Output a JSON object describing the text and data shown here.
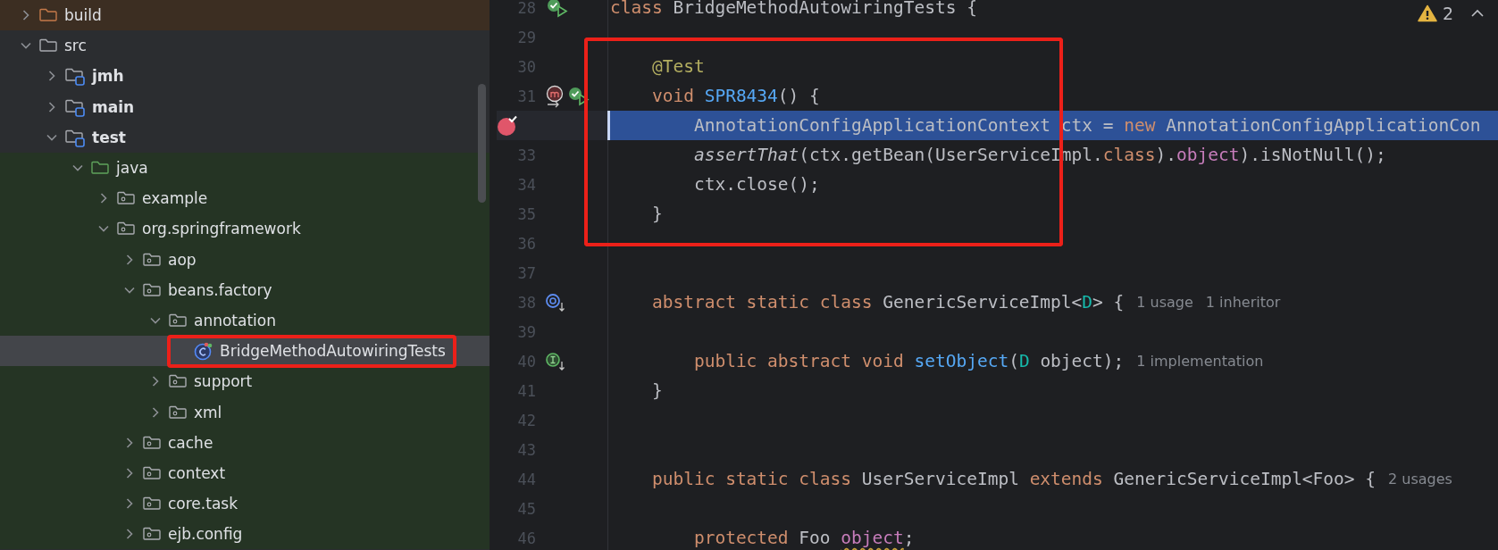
{
  "project_tree": {
    "items": [
      {
        "label": "build",
        "kind": "excluded",
        "test_sources": false,
        "expanded": false,
        "selected": false
      },
      {
        "label": "src",
        "kind": "folder",
        "test_sources": false,
        "expanded": true,
        "selected": false,
        "children": [
          {
            "label": "jmh",
            "kind": "module",
            "test_sources": false,
            "expanded": false,
            "selected": false
          },
          {
            "label": "main",
            "kind": "module",
            "test_sources": false,
            "expanded": false,
            "selected": false
          },
          {
            "label": "test",
            "kind": "module",
            "test_sources": false,
            "expanded": true,
            "selected": false,
            "children": [
              {
                "label": "java",
                "kind": "source-root",
                "test_sources": true,
                "expanded": true,
                "selected": false,
                "children": [
                  {
                    "label": "example",
                    "kind": "package",
                    "test_sources": true,
                    "expanded": false,
                    "selected": false
                  },
                  {
                    "label": "org.springframework",
                    "kind": "package",
                    "test_sources": true,
                    "expanded": true,
                    "selected": false,
                    "children": [
                      {
                        "label": "aop",
                        "kind": "package",
                        "test_sources": true,
                        "expanded": false,
                        "selected": false
                      },
                      {
                        "label": "beans.factory",
                        "kind": "package",
                        "test_sources": true,
                        "expanded": true,
                        "selected": false,
                        "children": [
                          {
                            "label": "annotation",
                            "kind": "package",
                            "test_sources": true,
                            "expanded": true,
                            "selected": false,
                            "children": [
                              {
                                "label": "BridgeMethodAutowiringTests",
                                "kind": "class",
                                "selected": true,
                                "framed": true
                              }
                            ]
                          },
                          {
                            "label": "support",
                            "kind": "package",
                            "test_sources": true,
                            "expanded": false,
                            "selected": false
                          },
                          {
                            "label": "xml",
                            "kind": "package",
                            "test_sources": true,
                            "expanded": false,
                            "selected": false
                          }
                        ]
                      },
                      {
                        "label": "cache",
                        "kind": "package",
                        "test_sources": true,
                        "expanded": false,
                        "selected": false
                      },
                      {
                        "label": "context",
                        "kind": "package",
                        "test_sources": true,
                        "expanded": false,
                        "selected": false
                      },
                      {
                        "label": "core.task",
                        "kind": "package",
                        "test_sources": true,
                        "expanded": false,
                        "selected": false
                      },
                      {
                        "label": "ejb.config",
                        "kind": "package",
                        "test_sources": true,
                        "expanded": false,
                        "selected": false
                      }
                    ]
                  }
                ]
              }
            ]
          }
        ]
      }
    ]
  },
  "editor": {
    "warning_count": "2",
    "lines": [
      {
        "number": "28",
        "gutter": [
          {
            "kind": "run"
          }
        ],
        "tokens": [
          {
            "text": "class",
            "kind": "keyword"
          },
          {
            "text": " BridgeMethodAutowiringTests {",
            "kind": "plain"
          }
        ]
      },
      {
        "number": "29"
      },
      {
        "number": "30",
        "framed": true,
        "tokens": [
          {
            "text": "    @Test",
            "kind": "annotation"
          }
        ]
      },
      {
        "number": "31",
        "framed": true,
        "gutter": [
          {
            "kind": "method"
          },
          {
            "kind": "run"
          }
        ],
        "tokens": [
          {
            "text": "    void",
            "kind": "keyword"
          },
          {
            "text": " SPR8434",
            "kind": "declaration"
          },
          {
            "text": "() {",
            "kind": "plain"
          }
        ]
      },
      {
        "framed": true,
        "current": true,
        "gutter": [
          {
            "kind": "breakpoint"
          }
        ],
        "tokens": [
          {
            "text": "        AnnotationConfigApplicationContext ctx = ",
            "kind": "plain"
          },
          {
            "text": "new",
            "kind": "keyword"
          },
          {
            "text": " AnnotationConfigApplicationCon",
            "kind": "plain"
          }
        ]
      },
      {
        "number": "33",
        "framed": true,
        "tokens": [
          {
            "text": "        assertThat",
            "kind": "static-call"
          },
          {
            "text": "(ctx.getBean(UserServiceImpl.",
            "kind": "plain"
          },
          {
            "text": "class",
            "kind": "keyword"
          },
          {
            "text": ").",
            "kind": "plain"
          },
          {
            "text": "object",
            "kind": "field"
          },
          {
            "text": ").isNotNull();",
            "kind": "plain"
          }
        ]
      },
      {
        "number": "34",
        "framed": true,
        "tokens": [
          {
            "text": "        ctx.close();",
            "kind": "plain"
          }
        ]
      },
      {
        "number": "35",
        "framed": true,
        "tokens": [
          {
            "text": "    }",
            "kind": "plain"
          }
        ]
      },
      {
        "number": "36"
      },
      {
        "number": "37"
      },
      {
        "number": "38",
        "gutter": [
          {
            "kind": "implemented"
          }
        ],
        "tokens": [
          {
            "text": "    abstract static class",
            "kind": "keyword"
          },
          {
            "text": " GenericServiceImpl<",
            "kind": "plain"
          },
          {
            "text": "D",
            "kind": "type-param"
          },
          {
            "text": "> {",
            "kind": "plain"
          }
        ],
        "hints": [
          "1 usage",
          "1 inheritor"
        ]
      },
      {
        "number": "39"
      },
      {
        "number": "40",
        "gutter": [
          {
            "kind": "interface"
          }
        ],
        "tokens": [
          {
            "text": "        public abstract void",
            "kind": "keyword"
          },
          {
            "text": " setObject",
            "kind": "declaration"
          },
          {
            "text": "(",
            "kind": "plain"
          },
          {
            "text": "D",
            "kind": "type-param"
          },
          {
            "text": " object);",
            "kind": "plain"
          }
        ],
        "hints": [
          "1 implementation"
        ]
      },
      {
        "number": "41",
        "tokens": [
          {
            "text": "    }",
            "kind": "plain"
          }
        ]
      },
      {
        "number": "42"
      },
      {
        "number": "43"
      },
      {
        "number": "44",
        "tokens": [
          {
            "text": "    public static class",
            "kind": "keyword"
          },
          {
            "text": " UserServiceImpl ",
            "kind": "plain"
          },
          {
            "text": "extends",
            "kind": "keyword"
          },
          {
            "text": " GenericServiceImpl<Foo> {",
            "kind": "plain"
          }
        ],
        "hints": [
          "2 usages"
        ]
      },
      {
        "number": "45"
      },
      {
        "number": "46",
        "tokens": [
          {
            "text": "        protected",
            "kind": "keyword"
          },
          {
            "text": " Foo ",
            "kind": "plain"
          },
          {
            "text": "object",
            "kind": "field",
            "warning": true
          },
          {
            "text": ";",
            "kind": "plain"
          }
        ]
      }
    ]
  }
}
